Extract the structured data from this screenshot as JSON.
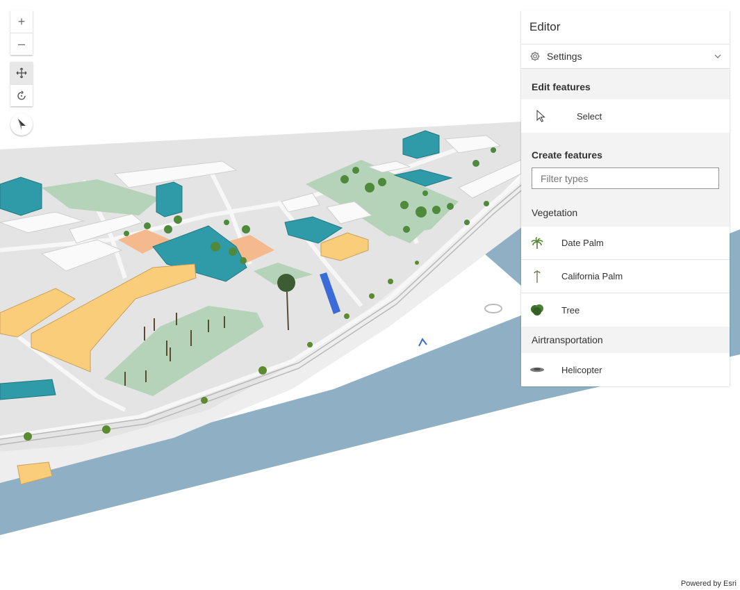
{
  "map_view": {
    "zoom_in_label": "+",
    "zoom_out_label": "–",
    "attribution": "Powered by Esri"
  },
  "editor": {
    "title": "Editor",
    "settings_label": "Settings",
    "edit_features_heading": "Edit features",
    "select_label": "Select",
    "create_features_heading": "Create features",
    "filter_placeholder": "Filter types",
    "groups": [
      {
        "name": "Vegetation",
        "items": [
          {
            "label": "Date Palm",
            "icon": "date-palm-icon"
          },
          {
            "label": "California Palm",
            "icon": "california-palm-icon"
          },
          {
            "label": "Tree",
            "icon": "tree-icon"
          }
        ]
      },
      {
        "name": "Airtransportation",
        "items": [
          {
            "label": "Helicopter",
            "icon": "helicopter-icon"
          }
        ]
      }
    ]
  }
}
